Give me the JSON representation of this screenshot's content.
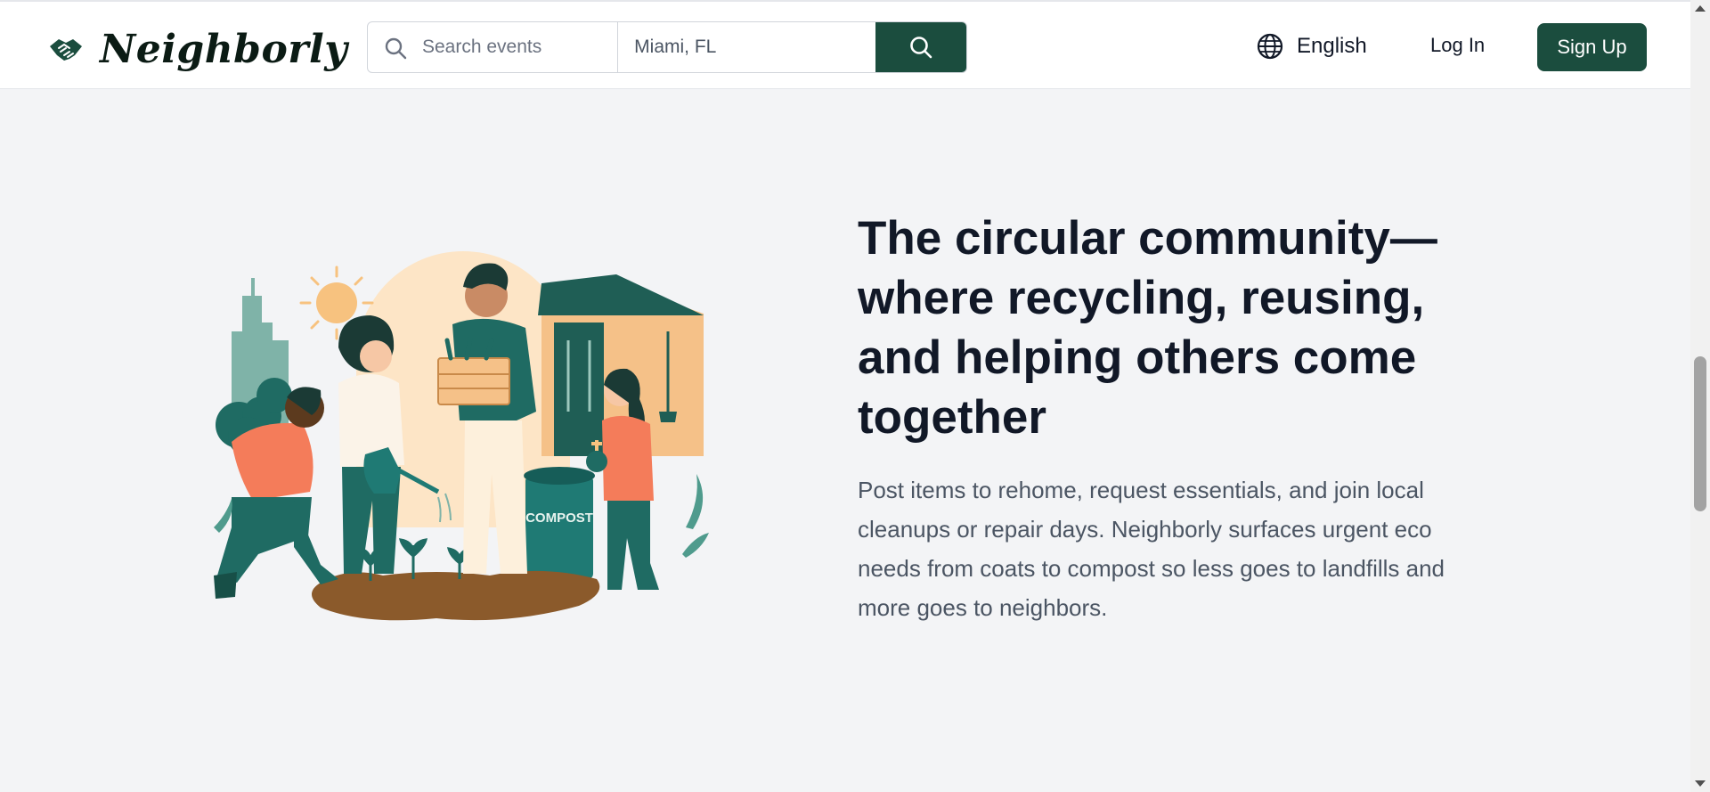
{
  "brand": {
    "name": "Neighborly"
  },
  "header": {
    "search_placeholder": "Search events",
    "location_value": "Miami, FL",
    "language_label": "English",
    "login_label": "Log In",
    "signup_label": "Sign Up"
  },
  "hero": {
    "headline": "The circular community—where recycling, reusing, and helping others come together",
    "description": "Post items to rehome, request essentials, and join local cleanups or repair days. Neighborly surfaces urgent eco needs from coats to compost so less goes to landfills and more goes to neighbors.",
    "illustration": {
      "bin_label": "COMPOST"
    }
  },
  "icons": {
    "logo": "handshake-icon",
    "search": "search-icon",
    "language": "globe-icon"
  },
  "colors": {
    "brand_green": "#1b4d3e",
    "teal": "#1f6b63",
    "orange": "#f47c5a",
    "background": "#f3f4f6"
  }
}
